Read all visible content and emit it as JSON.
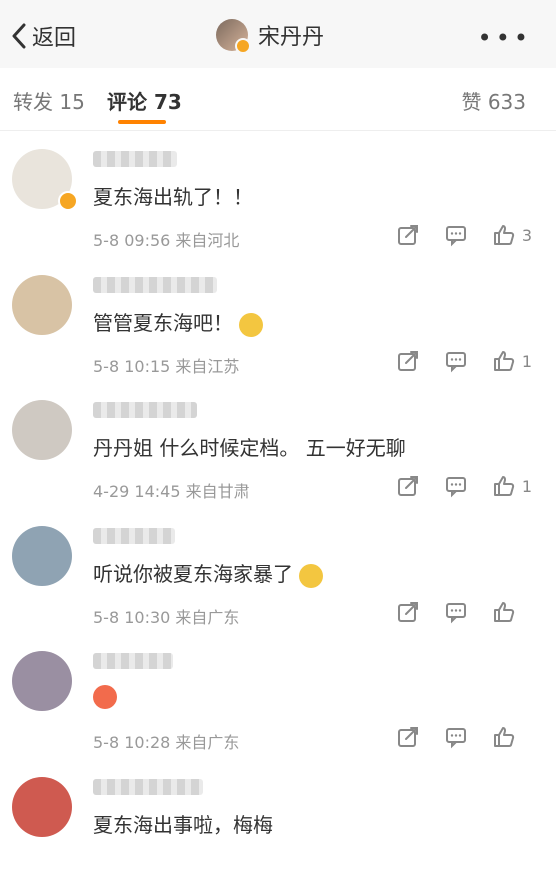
{
  "topbar": {
    "back_label": "返回",
    "title": "宋丹丹",
    "more": "•••"
  },
  "tabs": {
    "repost": "转发 15",
    "comment": "评论 73",
    "likes": "赞 633"
  },
  "comments": [
    {
      "text": "夏东海出轨了！！",
      "meta": "5-8 09:56 来自河北",
      "likes": "3",
      "verified": true,
      "avatar_color": "#e9e4dc"
    },
    {
      "text": "管管夏东海吧！",
      "meta": "5-8 10:15 来自江苏",
      "likes": "1",
      "verified": false,
      "avatar_color": "#d8c3a5"
    },
    {
      "text": "丹丹姐 什么时候定档。 五一好无聊",
      "meta": "4-29 14:45 来自甘肃",
      "likes": "1",
      "verified": false,
      "avatar_color": "#cfc9c2"
    },
    {
      "text": "听说你被夏东海家暴了",
      "meta": "5-8 10:30 来自广东",
      "likes": "",
      "verified": false,
      "avatar_color": "#8fa3b3"
    },
    {
      "text": "",
      "meta": "5-8 10:28 来自广东",
      "likes": "",
      "verified": false,
      "avatar_color": "#9a8fa2"
    },
    {
      "text": "夏东海出事啦，梅梅",
      "meta": "",
      "likes": "",
      "verified": false,
      "avatar_color": "#cf5a50"
    }
  ],
  "icons": [
    "chevron-left-icon",
    "more-icon",
    "share-icon",
    "comment-icon",
    "like-icon"
  ],
  "colors": {
    "accent": "#ff8200",
    "verified": "#f6a623"
  }
}
